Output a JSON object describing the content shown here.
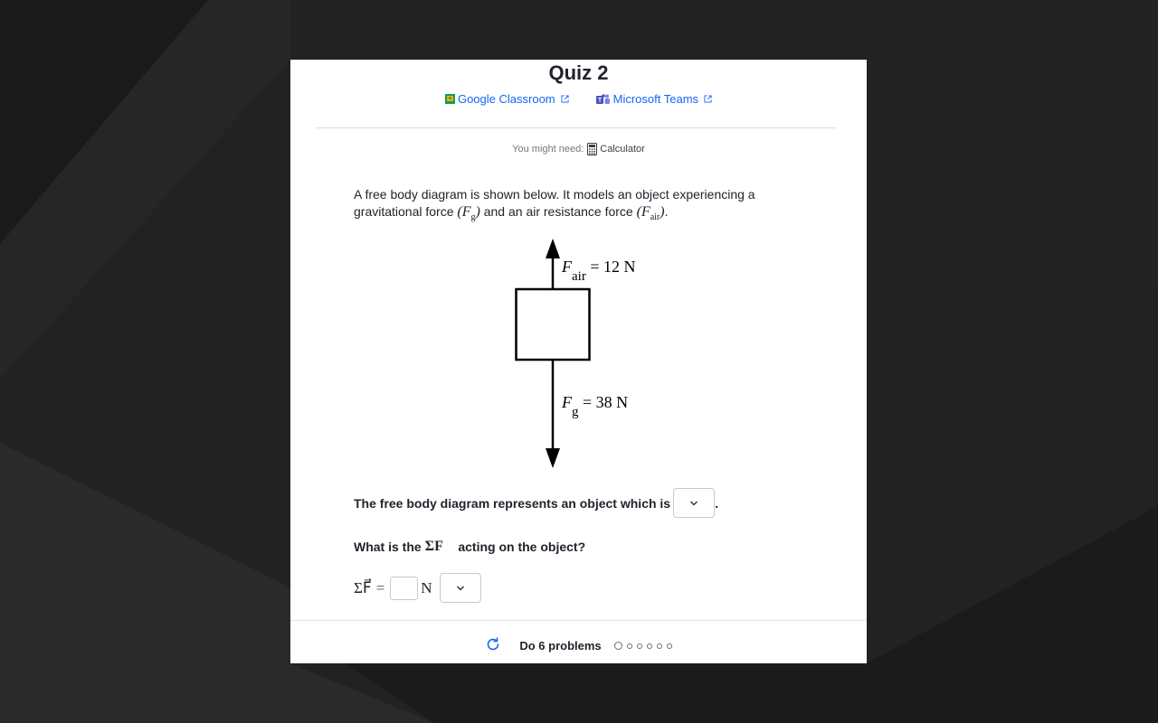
{
  "quiz": {
    "title": "Quiz 2"
  },
  "share": {
    "google_label": "Google Classroom",
    "teams_label": "Microsoft Teams"
  },
  "tools": {
    "prefix": "You might need:",
    "calculator_label": "Calculator"
  },
  "question": {
    "text_part1": "A free body diagram is shown below. It models an object experiencing a gravitational force ",
    "fg_symbol": "F",
    "fg_sub": "g",
    "text_part2": " and an air resistance force ",
    "fair_symbol": "F",
    "fair_sub": "air",
    "text_part3": "."
  },
  "diagram": {
    "up_label_symbol": "F",
    "up_label_sub": "air",
    "up_label_value": " = 12 N",
    "down_label_symbol": "F",
    "down_label_sub": "g",
    "down_label_value": " = 38 N"
  },
  "part1": {
    "prompt": "The free body diagram represents an object which is",
    "suffix": "."
  },
  "part2": {
    "prompt_before": "What is the",
    "prompt_math": "ΣF⃗",
    "prompt_after": "acting on the object?"
  },
  "answer": {
    "lhs": "ΣF⃗",
    "equals": "=",
    "unit": "N"
  },
  "footer": {
    "label": "Do 6 problems",
    "total_problems": 6,
    "current_problem": 1
  },
  "colors": {
    "link": "#1865f2",
    "background": "#1f1f1f",
    "card": "#ffffff"
  }
}
